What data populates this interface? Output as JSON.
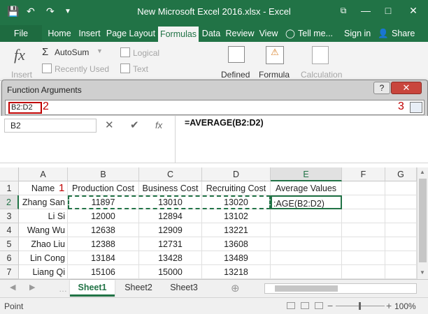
{
  "window": {
    "title": "New Microsoft Excel 2016.xlsx - Excel",
    "quick_access": {
      "save_icon": "save-icon",
      "undo_icon": "undo-icon",
      "redo_icon": "redo-icon",
      "customize_icon": "customize-icon"
    },
    "controls": {
      "restore": "⧉",
      "minimize": "—",
      "maximize": "□",
      "close": "✕"
    }
  },
  "ribbon_tabs": {
    "file": "File",
    "home": "Home",
    "insert": "Insert",
    "page_layout": "Page Layout",
    "formulas": "Formulas",
    "data": "Data",
    "review": "Review",
    "view": "View",
    "tell_me": "Tell me...",
    "sign_in": "Sign in",
    "share": "Share"
  },
  "ribbon": {
    "insert_function_label": "Insert",
    "autosum": "AutoSum",
    "recently_used": "Recently Used",
    "logical": "Logical",
    "text": "Text",
    "defined": "Defined",
    "formula": "Formula",
    "calculation": "Calculation"
  },
  "dialog": {
    "title": "Function Arguments",
    "help": "?",
    "close": "✕",
    "range_value": "B2:D2",
    "callout_1": "1",
    "callout_2": "2",
    "callout_3": "3"
  },
  "formula_bar": {
    "name_box": "B2",
    "cancel": "✕",
    "enter": "✔",
    "fx": "fx",
    "formula": "=AVERAGE(B2:D2)"
  },
  "grid": {
    "columns": [
      "A",
      "B",
      "C",
      "D",
      "E",
      "F",
      "G"
    ],
    "rows": [
      {
        "n": "1",
        "A": "Name",
        "B": "Production Cost",
        "C": "Business Cost",
        "D": "Recruiting Cost",
        "E": "Average Values"
      },
      {
        "n": "2",
        "A": "Zhang San",
        "B": "11897",
        "C": "13010",
        "D": "13020",
        "E": ":AGE(B2:D2)"
      },
      {
        "n": "3",
        "A": "Li Si",
        "B": "12000",
        "C": "12894",
        "D": "13102",
        "E": ""
      },
      {
        "n": "4",
        "A": "Wang Wu",
        "B": "12638",
        "C": "12909",
        "D": "13221",
        "E": ""
      },
      {
        "n": "5",
        "A": "Zhao Liu",
        "B": "12388",
        "C": "12731",
        "D": "13608",
        "E": ""
      },
      {
        "n": "6",
        "A": "Lin Cong",
        "B": "13184",
        "C": "13428",
        "D": "13489",
        "E": ""
      },
      {
        "n": "7",
        "A": "Liang Qi",
        "B": "15106",
        "C": "15000",
        "D": "13218",
        "E": ""
      }
    ]
  },
  "sheets": {
    "sheet1": "Sheet1",
    "sheet2": "Sheet2",
    "sheet3": "Sheet3",
    "add": "⊕"
  },
  "status": {
    "mode": "Point",
    "zoom": "100%",
    "zoom_minus": "−",
    "zoom_plus": "+"
  },
  "colors": {
    "excel_green": "#217346",
    "callout_red": "#c00000"
  }
}
